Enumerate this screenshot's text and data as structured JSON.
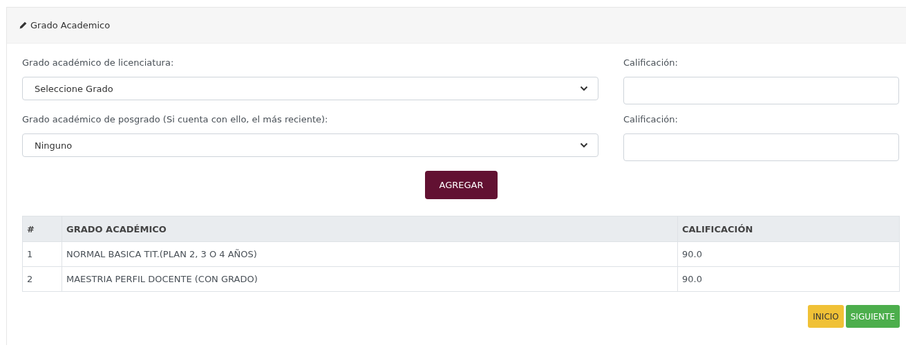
{
  "card": {
    "title": "Grado Academico"
  },
  "form": {
    "rows": [
      {
        "select_label": "Grado académico de licenciatura:",
        "select_value": "Seleccione Grado",
        "score_label": "Calificación:"
      },
      {
        "select_label": "Grado académico de posgrado (Si cuenta con ello, el más reciente):",
        "select_value": "Ninguno",
        "score_label": "Calificación:"
      }
    ],
    "add_button": "AGREGAR"
  },
  "table": {
    "columns": [
      "#",
      "GRADO ACADÉMICO",
      "CALIFICACIÓN"
    ],
    "rows": [
      [
        "1",
        "NORMAL BASICA TIT.(PLAN 2, 3 O 4 AÑOS)",
        "90.0"
      ],
      [
        "2",
        "MAESTRIA PERFIL DOCENTE (CON GRADO)",
        "90.0"
      ]
    ]
  },
  "buttons": [
    {
      "label": "INICIO",
      "kind": "warning"
    },
    {
      "label": "SIGUIENTE",
      "kind": "success"
    }
  ]
}
